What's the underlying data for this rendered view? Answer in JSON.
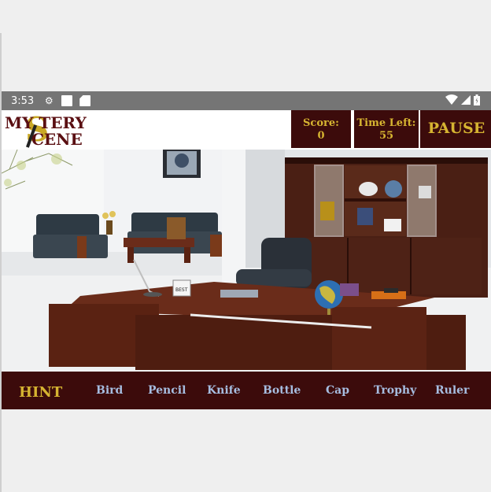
{
  "status_bar": {
    "time": "3:53",
    "icons": [
      "gear-icon",
      "a-box-icon",
      "sd-card-icon",
      "wifi-icon",
      "signal-icon",
      "battery-icon"
    ]
  },
  "logo": {
    "line1": "MY TERY",
    "line2": "CENE",
    "big_letter": "S"
  },
  "header": {
    "score_label": "Score:",
    "score_value": "0",
    "time_label": "Time Left:",
    "time_value": "55",
    "pause_label": "PAUSE"
  },
  "scene": {
    "description_icons": [
      "office-room",
      "desk",
      "chair",
      "globe",
      "mug",
      "cabinet",
      "sofa",
      "painting",
      "lamp"
    ]
  },
  "item_bar": {
    "hint_label": "HINT",
    "items": [
      "Bird",
      "Pencil",
      "Knife",
      "Bottle",
      "Cap",
      "Trophy",
      "Ruler"
    ]
  },
  "colors": {
    "bar_bg": "#3c0b0b",
    "gold": "#d6b431",
    "item_blue": "#a6bde0",
    "status_gray": "#757575",
    "logo_red": "#5a0f12"
  }
}
